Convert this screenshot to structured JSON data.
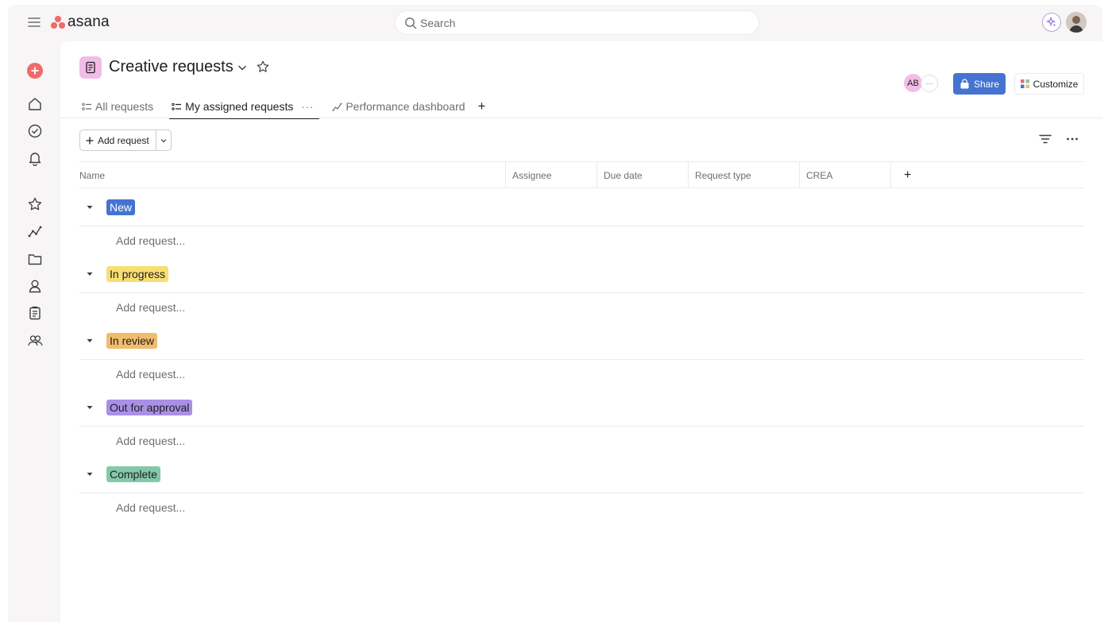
{
  "app": {
    "brand": "asana",
    "search_placeholder": "Search"
  },
  "project": {
    "title": "Creative requests",
    "tabs": [
      {
        "label": "All requests"
      },
      {
        "label": "My assigned requests",
        "more": "···"
      },
      {
        "label": "Performance dashboard"
      }
    ],
    "members": {
      "initials": "AB",
      "more": "···"
    },
    "share_label": "Share",
    "customize_label": "Customize"
  },
  "toolbar": {
    "add_request_label": "Add request"
  },
  "table": {
    "columns": [
      "Name",
      "Assignee",
      "Due date",
      "Request type",
      "CREA"
    ],
    "add_column": "+"
  },
  "sections": [
    {
      "label": "New",
      "add_label": "Add request..."
    },
    {
      "label": "In progress",
      "add_label": "Add request..."
    },
    {
      "label": "In review",
      "add_label": "Add request..."
    },
    {
      "label": "Out for approval",
      "add_label": "Add request..."
    },
    {
      "label": "Complete",
      "add_label": "Add request..."
    }
  ],
  "colors": {
    "brand": "#f06a6a",
    "accent": "#4573d2",
    "new": "#4573d2",
    "in_progress": "#f8df72",
    "in_review": "#f1bd6c",
    "out_for_approval": "#aa8fe6",
    "complete": "#83c9a9"
  },
  "icons": {
    "sidebar": [
      "create-icon",
      "home-icon",
      "my-tasks-icon",
      "inbox-icon",
      "favorites-icon",
      "reporting-icon",
      "projects-icon",
      "portfolios-icon",
      "goals-icon",
      "teams-icon"
    ]
  }
}
